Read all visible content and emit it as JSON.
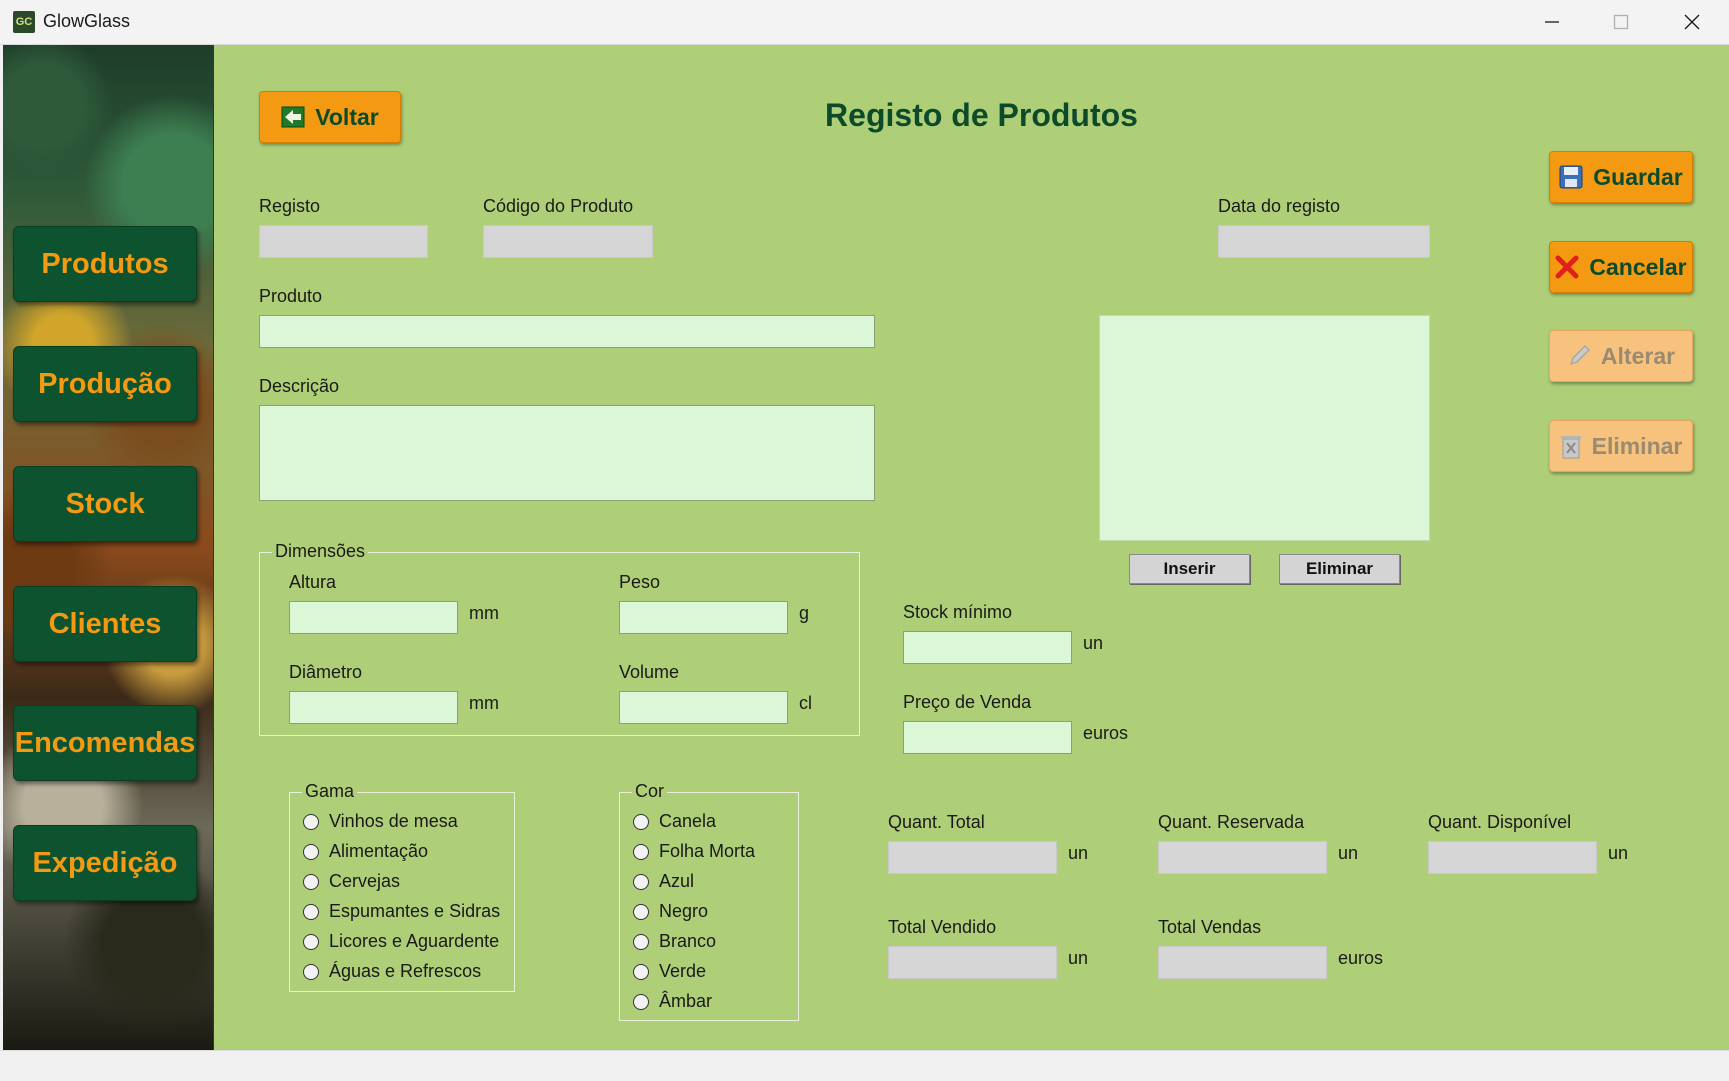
{
  "window": {
    "app_icon": "GC",
    "title": "GlowGlass"
  },
  "sidebar": {
    "items": [
      {
        "label": "Produtos"
      },
      {
        "label": "Produção"
      },
      {
        "label": "Stock"
      },
      {
        "label": "Clientes"
      },
      {
        "label": "Encomendas"
      },
      {
        "label": "Expedição"
      }
    ]
  },
  "header": {
    "title": "Registo de Produtos",
    "back_label": "Voltar"
  },
  "actions": {
    "guardar": "Guardar",
    "cancelar": "Cancelar",
    "alterar": "Alterar",
    "eliminar": "Eliminar"
  },
  "form": {
    "registo_label": "Registo",
    "codigo_label": "Código do Produto",
    "data_label": "Data do registo",
    "produto_label": "Produto",
    "descricao_label": "Descrição",
    "image_insert": "Inserir",
    "image_delete": "Eliminar",
    "dimensoes": {
      "legend": "Dimensões",
      "altura_label": "Altura",
      "altura_unit": "mm",
      "peso_label": "Peso",
      "peso_unit": "g",
      "diametro_label": "Diâmetro",
      "diametro_unit": "mm",
      "volume_label": "Volume",
      "volume_unit": "cl"
    },
    "stock_minimo_label": "Stock mínimo",
    "stock_minimo_unit": "un",
    "preco_label": "Preço de Venda",
    "preco_unit": "euros",
    "gama": {
      "legend": "Gama",
      "options": [
        "Vinhos de mesa",
        "Alimentação",
        "Cervejas",
        "Espumantes e Sidras",
        "Licores e Aguardente",
        "Águas e Refrescos"
      ]
    },
    "cor": {
      "legend": "Cor",
      "options": [
        "Canela",
        "Folha Morta",
        "Azul",
        "Negro",
        "Branco",
        "Verde",
        "Âmbar"
      ]
    },
    "quant_total_label": "Quant. Total",
    "quant_total_unit": "un",
    "quant_reservada_label": "Quant. Reservada",
    "quant_reservada_unit": "un",
    "quant_disponivel_label": "Quant. Disponível",
    "quant_disponivel_unit": "un",
    "total_vendido_label": "Total Vendido",
    "total_vendido_unit": "un",
    "total_vendas_label": "Total Vendas",
    "total_vendas_unit": "euros"
  }
}
